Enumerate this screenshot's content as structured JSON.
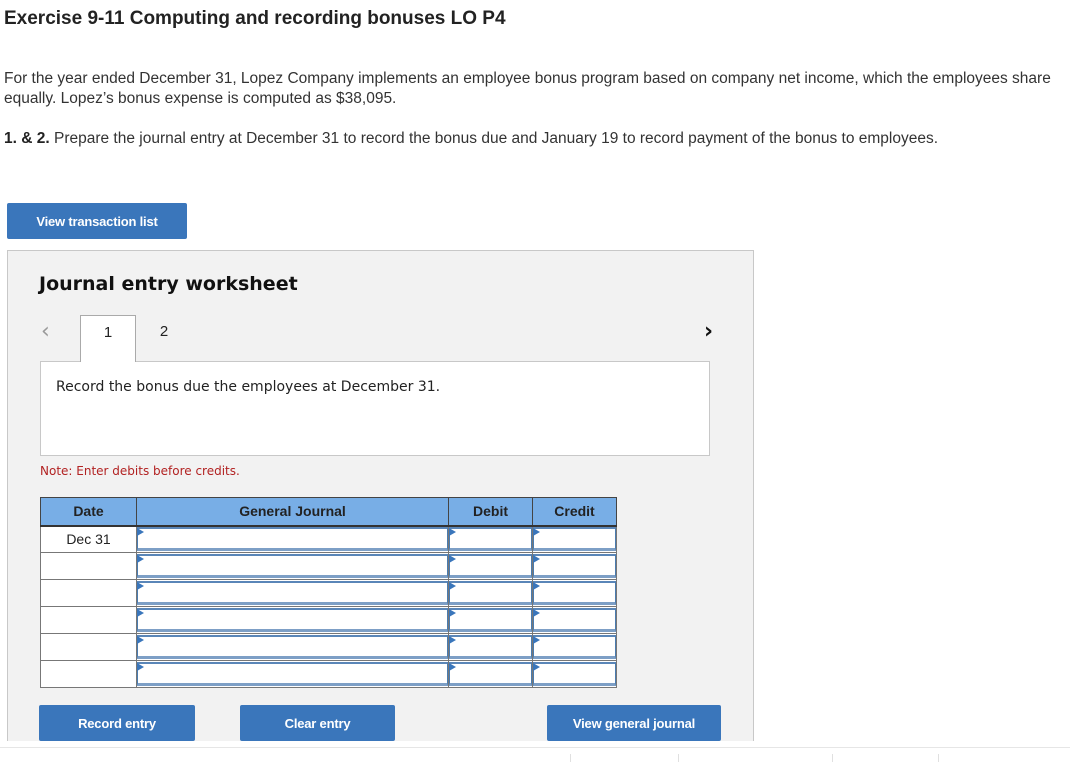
{
  "page": {
    "title": "Exercise 9-11 Computing and recording bonuses LO P4",
    "intro": "For the year ended December 31, Lopez Company implements an employee bonus program based on company net income, which the employees share equally. Lopez’s bonus expense is computed as $38,095.",
    "task_label": "1. & 2.",
    "task_text": " Prepare the journal entry at December 31 to record the bonus due and January 19 to record payment of the bonus to employees."
  },
  "buttons": {
    "view_transaction_list": "View transaction list",
    "record_entry": "Record entry",
    "clear_entry": "Clear entry",
    "view_general_journal": "View general journal"
  },
  "worksheet": {
    "title": "Journal entry worksheet",
    "prev_icon": "‹",
    "next_icon": "›",
    "tabs": [
      {
        "label": "1",
        "active": true
      },
      {
        "label": "2",
        "active": false
      }
    ],
    "instruction": "Record the bonus due the employees at December 31.",
    "note": "Note: Enter debits before credits."
  },
  "journal": {
    "headers": [
      "Date",
      "General Journal",
      "Debit",
      "Credit"
    ],
    "rows": [
      {
        "date": "Dec 31",
        "account": "",
        "debit": "",
        "credit": ""
      },
      {
        "date": "",
        "account": "",
        "debit": "",
        "credit": ""
      },
      {
        "date": "",
        "account": "",
        "debit": "",
        "credit": ""
      },
      {
        "date": "",
        "account": "",
        "debit": "",
        "credit": ""
      },
      {
        "date": "",
        "account": "",
        "debit": "",
        "credit": ""
      },
      {
        "date": "",
        "account": "",
        "debit": "",
        "credit": ""
      }
    ]
  }
}
